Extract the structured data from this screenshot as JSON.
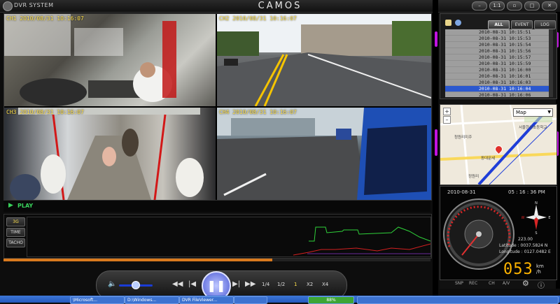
{
  "app": {
    "name": "DVR SYSTEM",
    "brand": "CAMOS"
  },
  "window_buttons": [
    "",
    "1:1",
    "",
    "",
    ""
  ],
  "cameras": [
    {
      "id": "ch1",
      "label": "CH1 2010/08/31 10:16:07"
    },
    {
      "id": "ch2",
      "label": "CH2 2010/08/31 10:16:07"
    },
    {
      "id": "ch3",
      "label": "CH3 2010/08/31 10:16:07"
    },
    {
      "id": "ch4",
      "label": "CH4 2010/08/31 10:16:07"
    }
  ],
  "playback": {
    "status": "PLAY"
  },
  "graph_buttons": [
    "3G",
    "TIME",
    "TACHO"
  ],
  "progress": 0.63,
  "speed_buttons": [
    "1/4",
    "1/2",
    "1",
    "X2",
    "X4"
  ],
  "tabs": [
    "ALL",
    "EVENT",
    "LOG"
  ],
  "events": [
    "2010-08-31 10:15:51",
    "2010-08-31 10:15:53",
    "2010-08-31 10:15:54",
    "2010-08-31 10:15:56",
    "2010-08-31 10:15:57",
    "2010-08-31 10:15:59",
    "2010-08-31 10:16:00",
    "2010-08-31 10:16:01",
    "2010-08-31 10:16:03",
    "2010-08-31 10:16:04",
    "2010-08-31 10:16:06"
  ],
  "selected_event_index": 9,
  "map": {
    "type": "Map",
    "labels": [
      "서울한성초등학교",
      "청원리미주",
      "동대문세",
      "정원리"
    ]
  },
  "gauge": {
    "date": "2010-08-31",
    "time": "05 : 16 : 36 PM",
    "heading": "223.00",
    "latitude_label": "Latitude :",
    "latitude": "0037.5824 N",
    "longitude_label": "Longitude :",
    "longitude": "0127.0482 E",
    "speed": "053",
    "unit_top": "km",
    "unit_bottom": "/h",
    "compass": [
      "N",
      "S",
      "W",
      "E"
    ]
  },
  "bottom_icons": [
    "SNP",
    "REC",
    "CH",
    "A/V"
  ],
  "taskbar": {
    "items": [
      "\\Microsoft...",
      "D:\\Windows...",
      "DVR FileViewer...",
      "",
      "88%",
      ""
    ]
  },
  "colors": {
    "camera_label": "#ffe04a",
    "play": "#39d15b",
    "speed_digits": "#ffb400",
    "selection": "#2b58cf",
    "progress": "#d97a1e"
  }
}
